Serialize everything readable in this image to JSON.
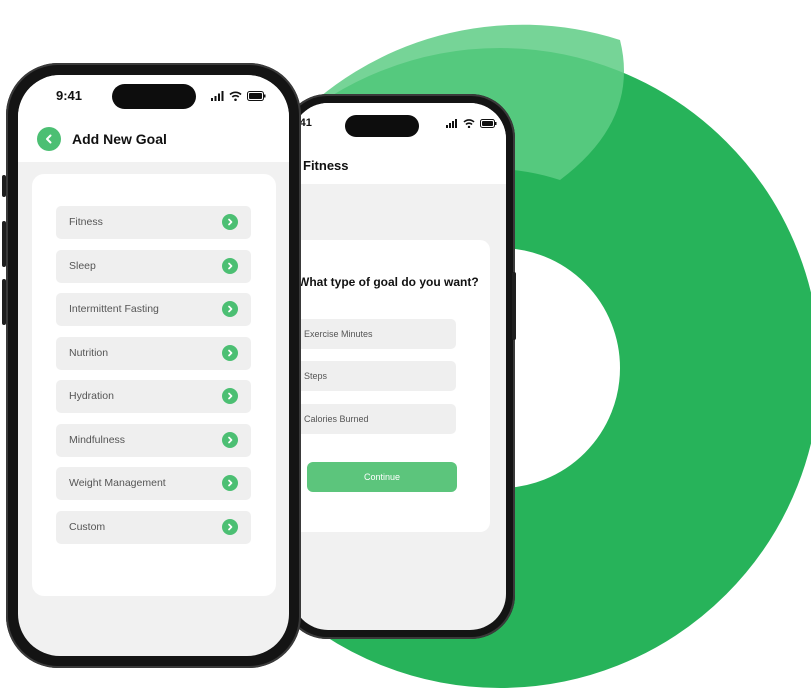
{
  "colors": {
    "accent": "#4cbf73",
    "ring": "#27b35a",
    "button": "#5cc57c"
  },
  "front_phone": {
    "status_time": "9:41",
    "title": "Add New Goal",
    "back_icon": "chevron-left-icon",
    "goals": [
      {
        "label": "Fitness"
      },
      {
        "label": "Sleep"
      },
      {
        "label": "Intermittent Fasting"
      },
      {
        "label": "Nutrition"
      },
      {
        "label": "Hydration"
      },
      {
        "label": "Mindfulness"
      },
      {
        "label": "Weight Management"
      },
      {
        "label": "Custom"
      }
    ],
    "item_icon": "chevron-right-icon"
  },
  "back_phone": {
    "status_time": ":41",
    "title": "Fitness",
    "question": "What type of goal do you want?",
    "options": [
      {
        "label": "Exercise Minutes"
      },
      {
        "label": "Steps"
      },
      {
        "label": "Calories Burned"
      }
    ],
    "continue_label": "Continue"
  }
}
